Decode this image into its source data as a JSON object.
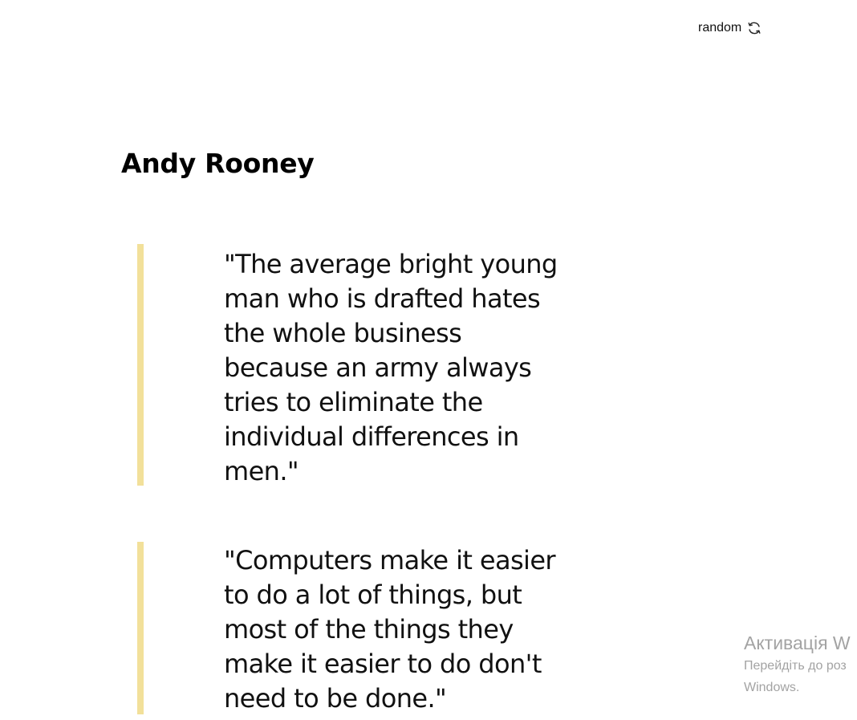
{
  "header": {
    "random_label": "random",
    "random_icon": "refresh-icon"
  },
  "author": {
    "name": "Andy Rooney"
  },
  "quotes": [
    {
      "text": "\"The average bright young\nman who is drafted hates\nthe whole business\nbecause an army always\ntries to eliminate the\nindividual differences in\nmen.\""
    },
    {
      "text": "\"Computers make it easier\nto do a lot of things, but\nmost of the things they\nmake it easier to do don't\nneed to be done.\""
    }
  ],
  "watermark": {
    "title": "Активація W",
    "line1": "Перейдіть до роз",
    "line2": "Windows."
  },
  "colors": {
    "quote_bar": "#f2e09a",
    "watermark": "#a3a3a3"
  }
}
